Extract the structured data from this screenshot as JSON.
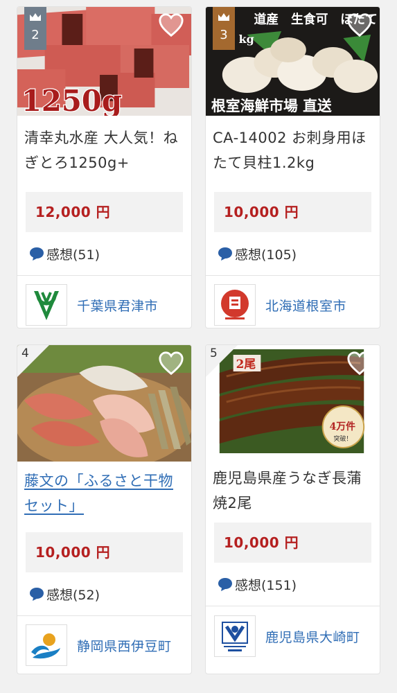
{
  "items": [
    {
      "rank": "2",
      "image_text": "1250g",
      "title": "清幸丸水産 大人気！ねぎとろ1250g+",
      "price": "12,000 円",
      "review": "感想(51)",
      "municipality": "千葉県君津市"
    },
    {
      "rank": "3",
      "image_text": "根室海鮮市場 直送",
      "image_header": "道産　生食可　ほたて",
      "image_kg": "kg",
      "title": "CA-14002 お刺身用ほたて貝柱1.2kg",
      "price": "10,000 円",
      "review": "感想(105)",
      "municipality": "北海道根室市"
    },
    {
      "rank": "4",
      "title": "藤文の「ふるさと干物セット」",
      "price": "10,000 円",
      "review": "感想(52)",
      "municipality": "静岡県西伊豆町"
    },
    {
      "rank": "5",
      "image_text": "2尾",
      "badge_text": "4万件",
      "badge_sub": "突破！",
      "title": "鹿児島県産うなぎ長蒲焼2尾",
      "price": "10,000 円",
      "review": "感想(151)",
      "municipality": "鹿児島県大崎町"
    }
  ],
  "colors": {
    "price": "#b52020",
    "link": "#2f6db5",
    "rank_silver": "#6f7d8b",
    "rank_bronze": "#a4692f",
    "review_icon": "#2a5fa6"
  }
}
